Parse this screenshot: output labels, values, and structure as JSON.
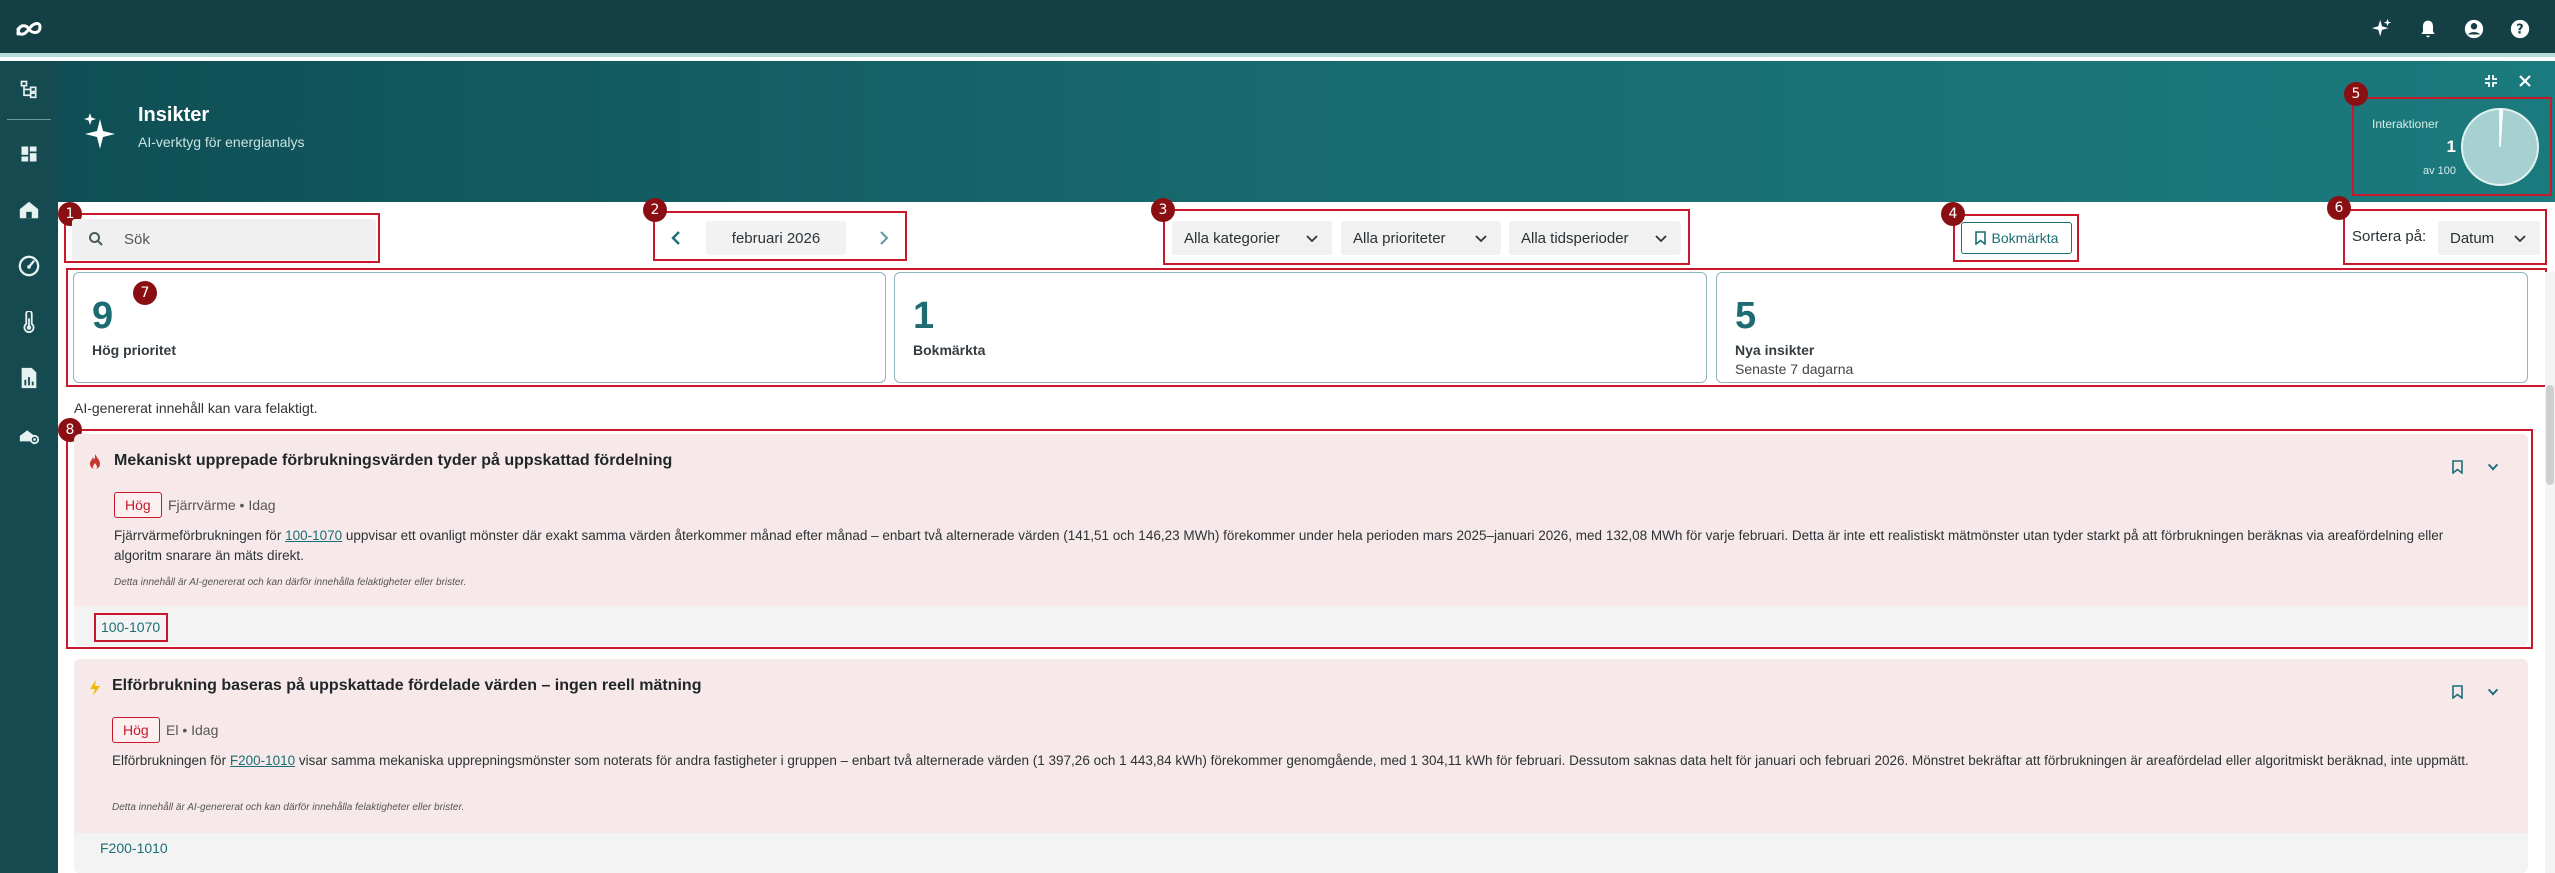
{
  "header": {
    "title": "Insikter",
    "subtitle": "AI-verktyg för energianalys",
    "interactions": {
      "label": "Interaktioner",
      "value": "1",
      "max_label": "av 100",
      "used_fraction": 0.01
    }
  },
  "toolbar": {
    "search_placeholder": "Sök",
    "month": "februari 2026",
    "filters": {
      "category": "Alla kategorier",
      "priority": "Alla prioriteter",
      "period": "Alla tidsperioder"
    },
    "bookmark_label": "Bokmärkta",
    "sort_label": "Sortera på:",
    "sort_value": "Datum"
  },
  "stats": [
    {
      "value": "9",
      "label": "Hög prioritet",
      "sub": ""
    },
    {
      "value": "1",
      "label": "Bokmärkta",
      "sub": ""
    },
    {
      "value": "5",
      "label": "Nya insikter",
      "sub": "Senaste 7 dagarna"
    }
  ],
  "disclaimer": "AI-genererat innehåll kan vara felaktigt.",
  "cards": [
    {
      "title": "Mekaniskt upprepade förbrukningsvärden tyder på uppskattad fördelning",
      "priority": "Hög",
      "meta": "Fjärrvärme • Idag",
      "body_pre": "Fjärrvärmeförbrukningen för ",
      "body_link": "100-1070",
      "body_post": " uppvisar ett ovanligt mönster där exakt samma värden återkommer månad efter månad – enbart två alternerade värden (141,51 och 146,23 MWh) förekommer under hela perioden mars 2025–januari 2026, med 132,08 MWh för varje februari. Detta är inte ett realistiskt mätmönster utan tyder starkt på att förbrukningen beräknas via areafördelning eller algoritm snarare än mäts direkt.",
      "note": "Detta innehåll är AI-genererat och kan därför innehålla felaktigheter eller brister.",
      "chip": "100-1070"
    },
    {
      "title": "Elförbrukning baseras på uppskattade fördelade värden – ingen reell mätning",
      "priority": "Hög",
      "meta": "El • Idag",
      "body_pre": "Elförbrukningen för ",
      "body_link": "F200-1010",
      "body_post": " visar samma mekaniska upprepningsmönster som noterats för andra fastigheter i gruppen – enbart två alternerade värden (1 397,26 och 1 443,84 kWh) förekommer genomgående, med 1 304,11 kWh för februari. Dessutom saknas data helt för januari och februari 2026. Mönstret bekräftar att förbrukningen är areafördelad eller algoritmiskt beräknad, inte uppmätt.",
      "note": "Detta innehåll är AI-genererat och kan därför innehålla felaktigheter eller brister.",
      "chip": "F200-1010"
    }
  ],
  "annotations": [
    "1",
    "2",
    "3",
    "4",
    "5",
    "6",
    "7",
    "8"
  ],
  "colors": {
    "topbar": "#143f45",
    "sidebar": "#154a50",
    "accent": "#1b6f75",
    "priority_high": "#c9182b",
    "card_bg": "#f7e9ea"
  },
  "icons": {
    "topbar": [
      "logo-icon",
      "sparkle-icon",
      "bell-icon",
      "account-icon",
      "help-icon"
    ],
    "sidebar": [
      "tree-icon",
      "dashboard-icon",
      "building-icon",
      "gauge-icon",
      "thermometer-icon",
      "report-icon",
      "settings-cluster-icon"
    ]
  }
}
